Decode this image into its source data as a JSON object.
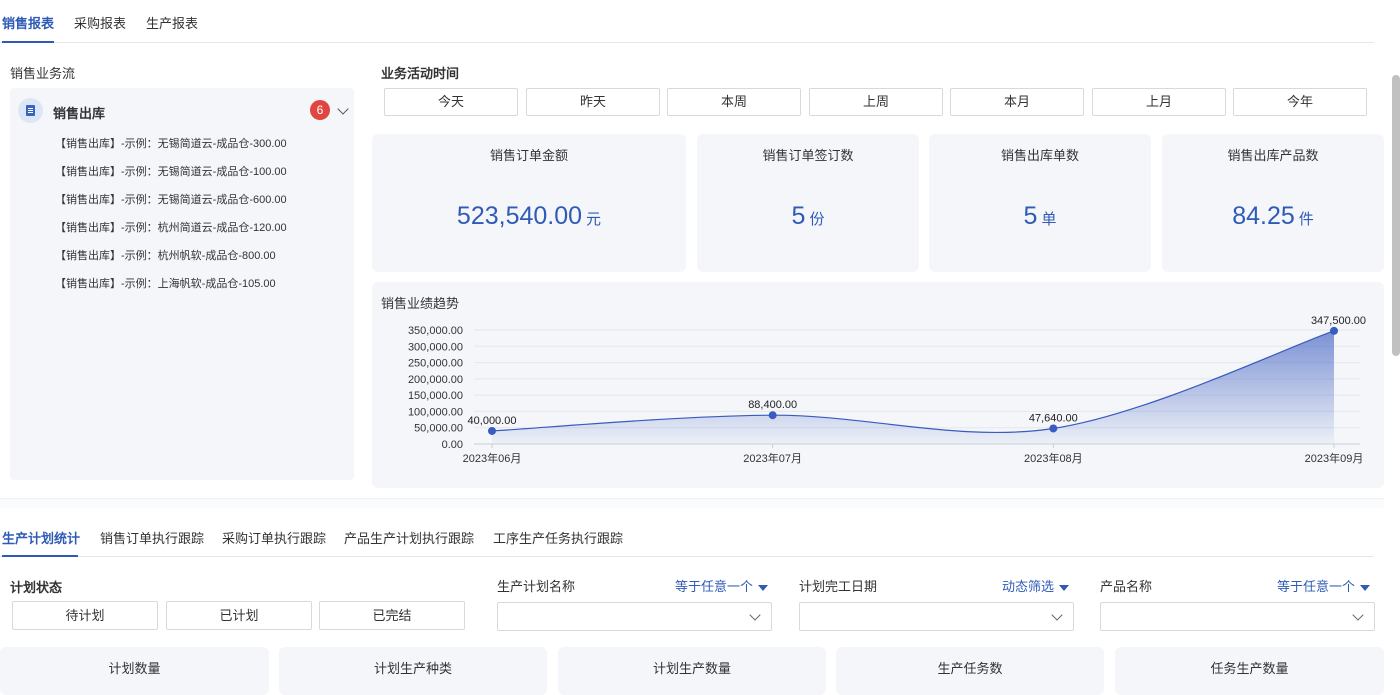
{
  "top_tabs": [
    {
      "label": "销售报表",
      "active": true
    },
    {
      "label": "采购报表",
      "active": false
    },
    {
      "label": "生产报表",
      "active": false
    }
  ],
  "sales_flow": {
    "title": "销售业务流",
    "head_label": "销售出库",
    "badge": "6",
    "items": [
      "【销售出库】-示例：无锡简道云-成品仓-300.00",
      "【销售出库】-示例：无锡简道云-成品仓-100.00",
      "【销售出库】-示例：无锡简道云-成品仓-600.00",
      "【销售出库】-示例：杭州简道云-成品仓-120.00",
      "【销售出库】-示例：杭州帆软-成品仓-800.00",
      "【销售出库】-示例：上海帆软-成品仓-105.00"
    ]
  },
  "activity_time": {
    "title": "业务活动时间",
    "options": [
      "今天",
      "昨天",
      "本周",
      "上周",
      "本月",
      "上月",
      "今年"
    ]
  },
  "kpis": [
    {
      "title": "销售订单金额",
      "value": "523,540.00",
      "unit": "元"
    },
    {
      "title": "销售订单签订数",
      "value": "5",
      "unit": "份"
    },
    {
      "title": "销售出库单数",
      "value": "5",
      "unit": "单"
    },
    {
      "title": "销售出库产品数",
      "value": "84.25",
      "unit": "件"
    }
  ],
  "chart_data": {
    "type": "area",
    "title": "销售业绩趋势",
    "categories": [
      "2023年06月",
      "2023年07月",
      "2023年08月",
      "2023年09月"
    ],
    "series": [
      {
        "values": [
          40000,
          88400,
          47640,
          347500
        ]
      }
    ],
    "data_labels": [
      "40,000.00",
      "88,400.00",
      "47,640.00",
      "347,500.00"
    ],
    "y_ticks": [
      "0.00",
      "50,000.00",
      "100,000.00",
      "150,000.00",
      "200,000.00",
      "250,000.00",
      "300,000.00",
      "350,000.00"
    ],
    "ylim": [
      0,
      350000
    ],
    "grid": true,
    "legend": "none",
    "color": "#3a5bbf"
  },
  "bottom_tabs": [
    {
      "label": "生产计划统计",
      "active": true
    },
    {
      "label": "销售订单执行跟踪",
      "active": false
    },
    {
      "label": "采购订单执行跟踪",
      "active": false
    },
    {
      "label": "产品生产计划执行跟踪",
      "active": false
    },
    {
      "label": "工序生产任务执行跟踪",
      "active": false
    }
  ],
  "plan_status": {
    "title": "计划状态",
    "options": [
      "待计划",
      "已计划",
      "已完结"
    ]
  },
  "filters": [
    {
      "label": "生产计划名称",
      "mode": "等于任意一个"
    },
    {
      "label": "计划完工日期",
      "mode": "动态筛选"
    },
    {
      "label": "产品名称",
      "mode": "等于任意一个"
    }
  ],
  "stat_cards": [
    "计划数量",
    "计划生产种类",
    "计划生产数量",
    "生产任务数",
    "任务生产数量"
  ],
  "colors": {
    "accent": "#2f5bb7",
    "badge": "#e0453f",
    "panel": "#f4f6fa"
  }
}
